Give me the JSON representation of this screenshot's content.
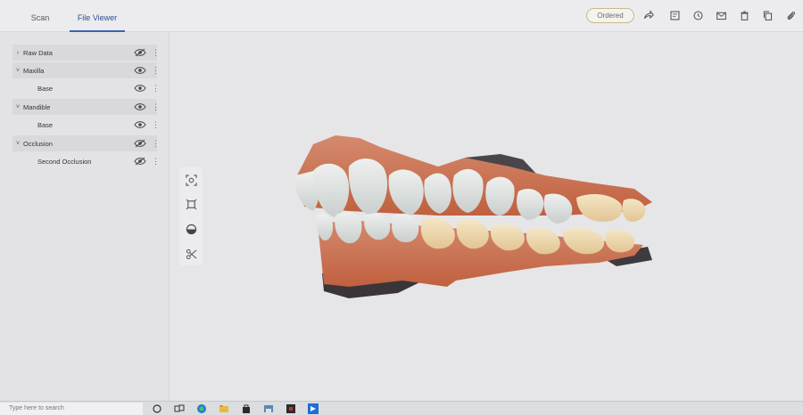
{
  "tabs": [
    {
      "label": "Scan"
    },
    {
      "label": "File Viewer"
    }
  ],
  "status": {
    "label": "Ordered"
  },
  "toolbar_icons": [
    "share-icon",
    "notes-icon",
    "history-icon",
    "mail-icon",
    "trash-icon",
    "copy-icon",
    "attachment-icon"
  ],
  "layers": [
    {
      "label": "Raw Data",
      "expander": "›",
      "visible": false
    },
    {
      "label": "Maxilla",
      "expander": "˅",
      "visible": true
    },
    {
      "label": "Base",
      "visible": true
    },
    {
      "label": "Mandible",
      "expander": "˅",
      "visible": true
    },
    {
      "label": "Base",
      "visible": true
    },
    {
      "label": "Occlusion",
      "expander": "˅",
      "visible": false
    },
    {
      "label": "Second Occlusion",
      "visible": false
    }
  ],
  "viewer_tools": [
    "fit-view-icon",
    "view-cube-icon",
    "half-circle-icon",
    "scissors-icon"
  ],
  "taskbar": {
    "search_placeholder": "Type here to search"
  },
  "colors": {
    "accent": "#3a63b5",
    "status_border": "#c9b98b"
  }
}
